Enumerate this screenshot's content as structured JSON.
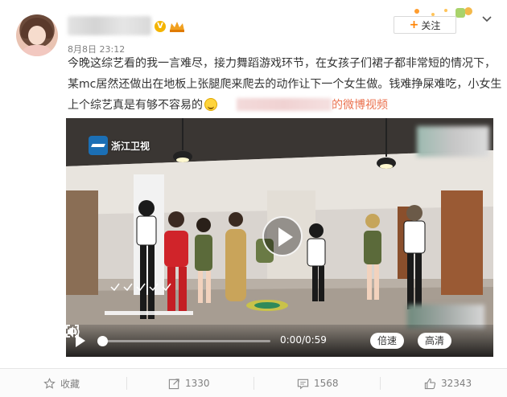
{
  "user": {
    "timestamp": "8月8日 23:12"
  },
  "header": {
    "follow_label": "关注"
  },
  "post": {
    "text_main": "今晚这综艺看的我一言难尽，接力舞蹈游戏环节，在女孩子们裙子都非常短的情况下，某mc居然还做出在地板上张腿爬来爬去的动作让下一个女生做。钱难挣屎难吃，小女生上个综艺真是有够不容易的",
    "video_link": "的微博视频"
  },
  "video": {
    "channel_logo": "浙江卫视",
    "time": "0:00/0:59",
    "speed_label": "倍速",
    "quality_label": "高清",
    "progress": 0.0
  },
  "actions": {
    "favorite_label": "收藏",
    "repost_count": "1330",
    "comment_count": "1568",
    "like_count": "32343"
  },
  "colors": {
    "accent": "#ff8200",
    "link": "#eb7350",
    "badge_gold": "#f4b400"
  }
}
